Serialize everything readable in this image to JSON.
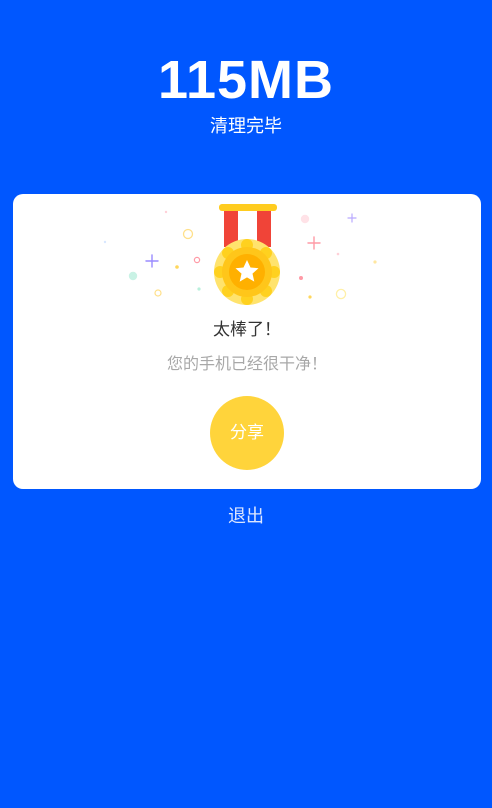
{
  "result": {
    "size": "115MB",
    "status": "清理完毕"
  },
  "card": {
    "title": "太棒了！",
    "subtitle": "您的手机已经很干净！",
    "share_label": "分享"
  },
  "footer": {
    "exit_label": "退出"
  },
  "colors": {
    "background": "#0057ff",
    "card": "#ffffff",
    "share_button": "#ffd43b",
    "medal_gold": "#ffc21a",
    "ribbon_red": "#f04438"
  },
  "icons": {
    "medal": "medal-icon",
    "star": "star-icon"
  }
}
